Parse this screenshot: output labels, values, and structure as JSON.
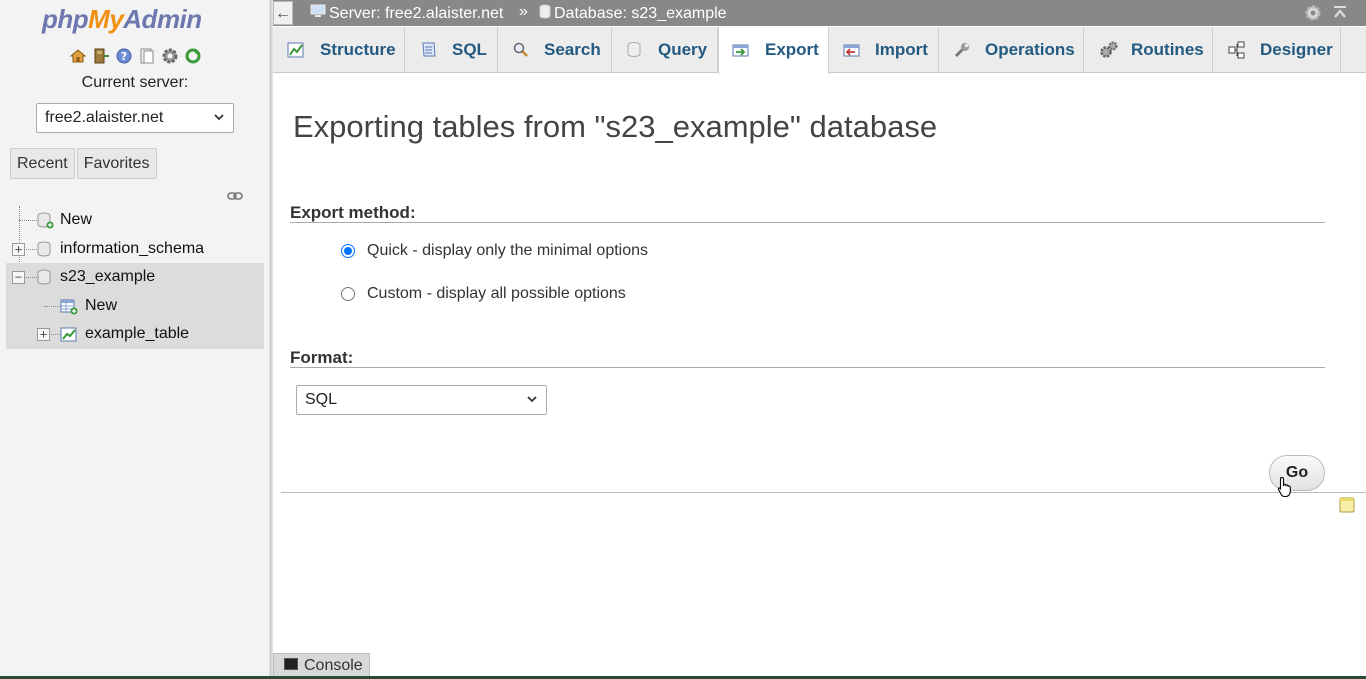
{
  "sidebar": {
    "logo": {
      "php": "php",
      "my": "My",
      "admin": "Admin"
    },
    "current_server_label": "Current server:",
    "server_select_value": "free2.alaister.net",
    "tabs": {
      "recent": "Recent",
      "favorites": "Favorites"
    },
    "tree": {
      "new": "New",
      "information_schema": "information_schema",
      "s23_example": "s23_example",
      "s23_new": "New",
      "example_table": "example_table"
    }
  },
  "topbar": {
    "back": "←",
    "server_crumb": "Server: free2.alaister.net",
    "separator": "»",
    "database_crumb": "Database: s23_example"
  },
  "tabs": [
    {
      "label": "Structure"
    },
    {
      "label": "SQL"
    },
    {
      "label": "Search"
    },
    {
      "label": "Query"
    },
    {
      "label": "Export"
    },
    {
      "label": "Import"
    },
    {
      "label": "Operations"
    },
    {
      "label": "Routines"
    },
    {
      "label": "Designer"
    }
  ],
  "active_tab": "Export",
  "main": {
    "title": "Exporting tables from \"s23_example\" database",
    "export_method_title": "Export method:",
    "quick_option": "Quick - display only the minimal options",
    "custom_option": "Custom - display all possible options",
    "selected_method": "quick",
    "format_title": "Format:",
    "format_value": "SQL",
    "go_label": "Go"
  },
  "console": {
    "label": "Console"
  },
  "colors": {
    "tab_text": "#235a81",
    "topbar": "#888888",
    "radio_accent": "#0075ff"
  }
}
